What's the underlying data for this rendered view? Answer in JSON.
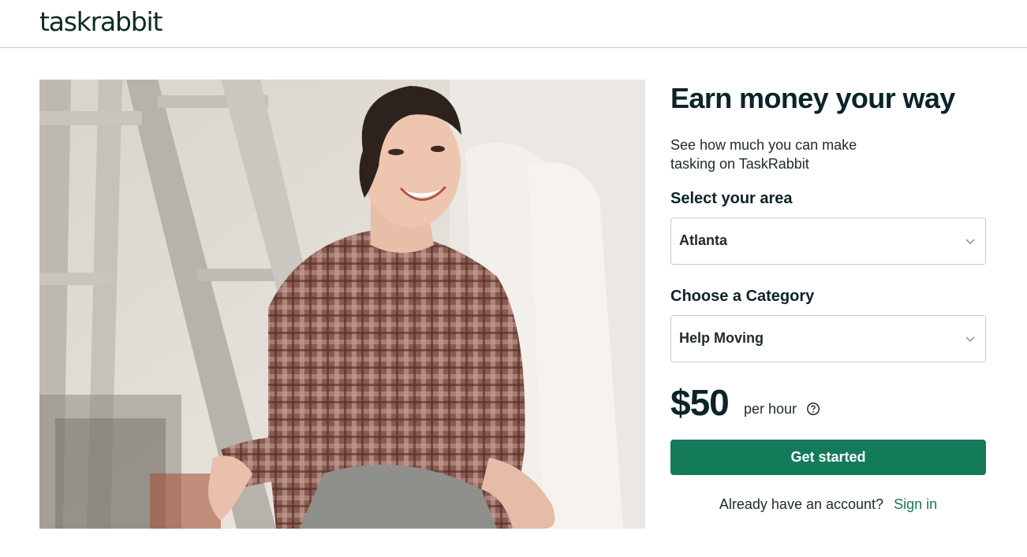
{
  "header": {
    "logo_text": "taskrabbit"
  },
  "hero": {
    "image_alt": "Smiling woman in plaid shirt sitting by a ladder"
  },
  "panel": {
    "title": "Earn money your way",
    "subtitle": "See how much you can make tasking on TaskRabbit",
    "area_label": "Select your area",
    "area_value": "Atlanta",
    "category_label": "Choose a Category",
    "category_value": "Help Moving",
    "price": "$50",
    "price_unit": "per hour",
    "cta_label": "Get started",
    "signin_prompt": "Already have an account?",
    "signin_link": "Sign in"
  },
  "colors": {
    "brand_green": "#137a5a",
    "heading": "#0b2427",
    "logo": "#0b2e1f"
  },
  "icons": {
    "dropdown": "chevron-down-icon",
    "help": "question-circle-icon"
  }
}
